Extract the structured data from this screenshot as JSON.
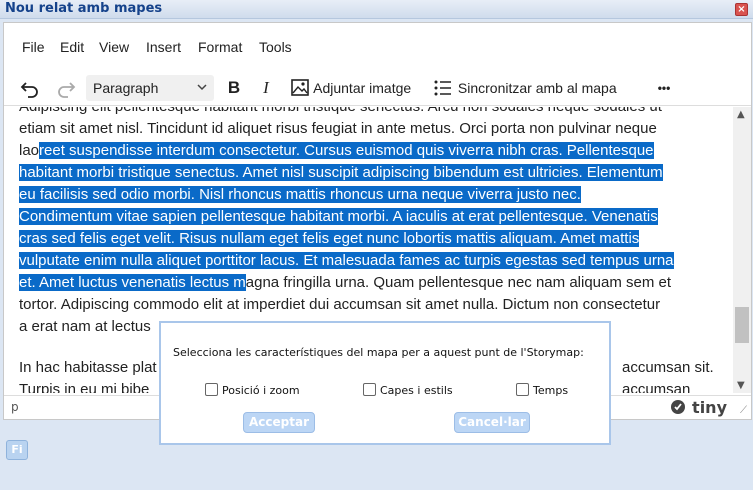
{
  "window": {
    "title": "Nou relat amb mapes",
    "close_label": "×"
  },
  "menubar": {
    "items": [
      "File",
      "Edit",
      "View",
      "Insert",
      "Format",
      "Tools"
    ]
  },
  "toolbar": {
    "undo_icon": "undo-icon",
    "redo_icon": "redo-icon",
    "block_format": "Paragraph",
    "bold_label": "B",
    "italic_label": "I",
    "insert_image_label": "Adjuntar imatge",
    "sync_map_label": "Sincronitzar amb al mapa",
    "more_label": "•••"
  },
  "content": {
    "p1_line0": "Adipiscing elit pellentesque habitant morbi tristique senectus. Arcu non sodales neque sodales ut",
    "p1_line1": "etiam sit amet nisl. Tincidunt id aliquet risus feugiat in ante metus. Orci porta non pulvinar neque",
    "p1_line2_pre": "lao",
    "p1_line2_sel": "reet suspendisse interdum consectetur. Cursus euismod quis viverra nibh cras. Pellentesque",
    "p1_line3_sel": "habitant morbi tristique senectus. Amet nisl suscipit adipiscing bibendum est ultricies. Elementum",
    "p1_line4_sel": "eu facilisis sed odio morbi. Nisl rhoncus mattis rhoncus urna neque viverra justo nec.",
    "p1_line5_sel": "Condimentum vitae sapien pellentesque habitant morbi. A iaculis at erat pellentesque. Venenatis",
    "p1_line6_sel": "cras sed felis eget velit. Risus nullam eget felis eget nunc lobortis mattis aliquam. Amet mattis",
    "p1_line7_sel": "vulputate enim nulla aliquet porttitor lacus. Et malesuada fames ac turpis egestas sed tempus urna",
    "p1_line8_sel": "et. Amet luctus venenatis lectus m",
    "p1_line8_post": "agna fringilla urna. Quam pellentesque nec nam aliquam sem et",
    "p1_line9": "tortor. Adipiscing commodo elit at imperdiet dui accumsan sit amet nulla. Dictum non consectetur",
    "p1_line10": "a erat nam at lectus",
    "p2_line0_pre": "In hac habitasse plat",
    "p2_line0_post": "accumsan sit.",
    "p2_line1_pre": "Turpis in eu mi bibe",
    "p2_line1_post": "accumsan"
  },
  "statusbar": {
    "path": "p",
    "brand": "tiny"
  },
  "bottom_button": "Fi",
  "dialog": {
    "prompt": "Selecciona les característiques del mapa per a aquest punt de l'Storymap:",
    "option1": "Posició i zoom",
    "option2": "Capes i estils",
    "option3": "Temps",
    "accept": "Acceptar",
    "cancel": "Cancel·lar"
  },
  "colors": {
    "selection": "#0a6ac8",
    "title": "#15428b",
    "dialog_border": "#a9c6ea"
  }
}
